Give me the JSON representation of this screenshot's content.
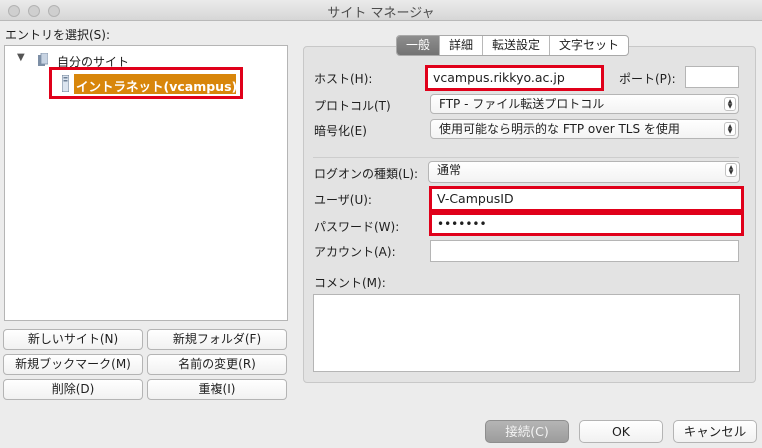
{
  "window": {
    "title": "サイト マネージャ"
  },
  "left": {
    "select_label": "エントリを選択(S):",
    "tree": {
      "root_label": "自分のサイト",
      "site_label": "イントラネット(vcampus)"
    },
    "buttons": {
      "new_site": "新しいサイト(N)",
      "new_folder": "新規フォルダ(F)",
      "new_bookmark": "新規ブックマーク(M)",
      "rename": "名前の変更(R)",
      "delete": "削除(D)",
      "duplicate": "重複(I)"
    }
  },
  "tabs": [
    {
      "label": "一般",
      "active": true
    },
    {
      "label": "詳細",
      "active": false
    },
    {
      "label": "転送設定",
      "active": false
    },
    {
      "label": "文字セット",
      "active": false
    }
  ],
  "form": {
    "host_label": "ホスト(H):",
    "host_value": "vcampus.rikkyo.ac.jp",
    "port_label": "ポート(P):",
    "port_value": "",
    "protocol_label": "プロトコル(T)",
    "protocol_value": "FTP - ファイル転送プロトコル",
    "encryption_label": "暗号化(E)",
    "encryption_value": "使用可能なら明示的な FTP over TLS を使用",
    "logon_type_label": "ログオンの種類(L):",
    "logon_type_value": "通常",
    "user_label": "ユーザ(U):",
    "user_value": "V-CampusID",
    "password_label": "パスワード(W):",
    "password_value": "•••••••",
    "account_label": "アカウント(A):",
    "account_value": "",
    "comment_label": "コメント(M):",
    "comment_value": ""
  },
  "footer": {
    "connect": "接続(C)",
    "ok": "OK",
    "cancel": "キャンセル"
  },
  "colors": {
    "highlight": "#e0001a",
    "selection": "#d8860b"
  }
}
